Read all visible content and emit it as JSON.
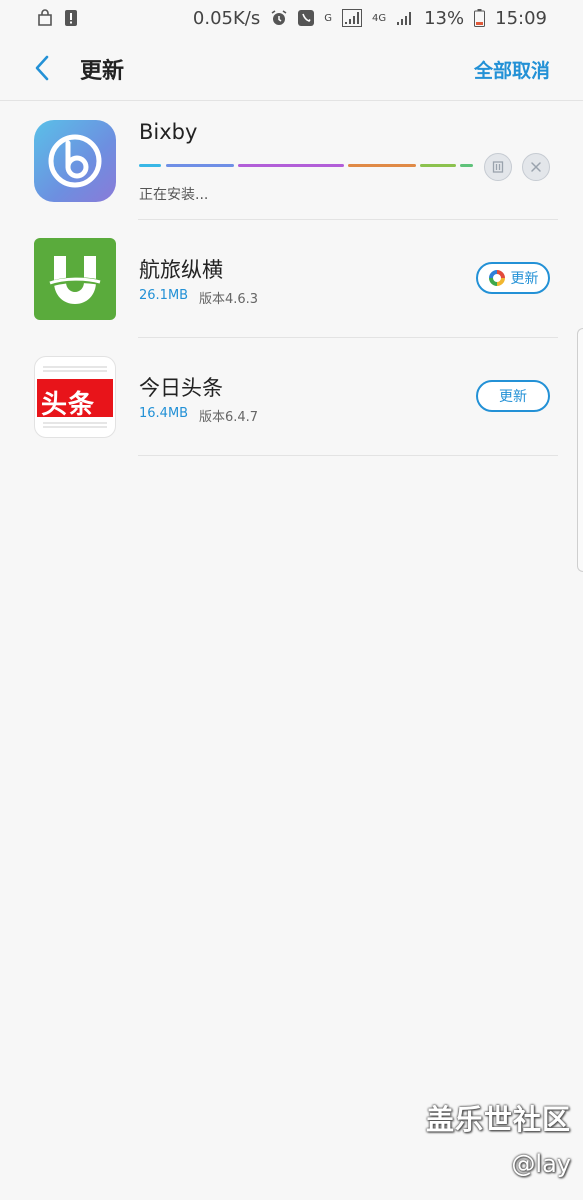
{
  "status_bar": {
    "speed": "0.05K/s",
    "battery": "13%",
    "time": "15:09",
    "network_g": "G",
    "network_4g": "4G"
  },
  "header": {
    "title": "更新",
    "cancel_all": "全部取消"
  },
  "apps": [
    {
      "name": "Bixby",
      "status": "正在安装...",
      "icon": "bixby-icon",
      "progress_colors": [
        "#39b7e6",
        "#6f8fe6",
        "#b25ed8",
        "#e0506a",
        "#e08a46",
        "#d7b43c",
        "#8cc24e",
        "#5fc27a"
      ]
    },
    {
      "name": "航旅纵横",
      "size": "26.1MB",
      "version": "版本4.6.3",
      "button": "更新",
      "icon": "hanglv-icon",
      "icon_label": "U"
    },
    {
      "name": "今日头条",
      "size": "16.4MB",
      "version": "版本6.4.7",
      "button": "更新",
      "icon": "toutiao-icon",
      "icon_label": "头条"
    }
  ],
  "watermark": {
    "main": "盖乐世社区",
    "sub": "@lay"
  },
  "colors": {
    "accent": "#2391d6",
    "background": "#f7f7f7"
  }
}
